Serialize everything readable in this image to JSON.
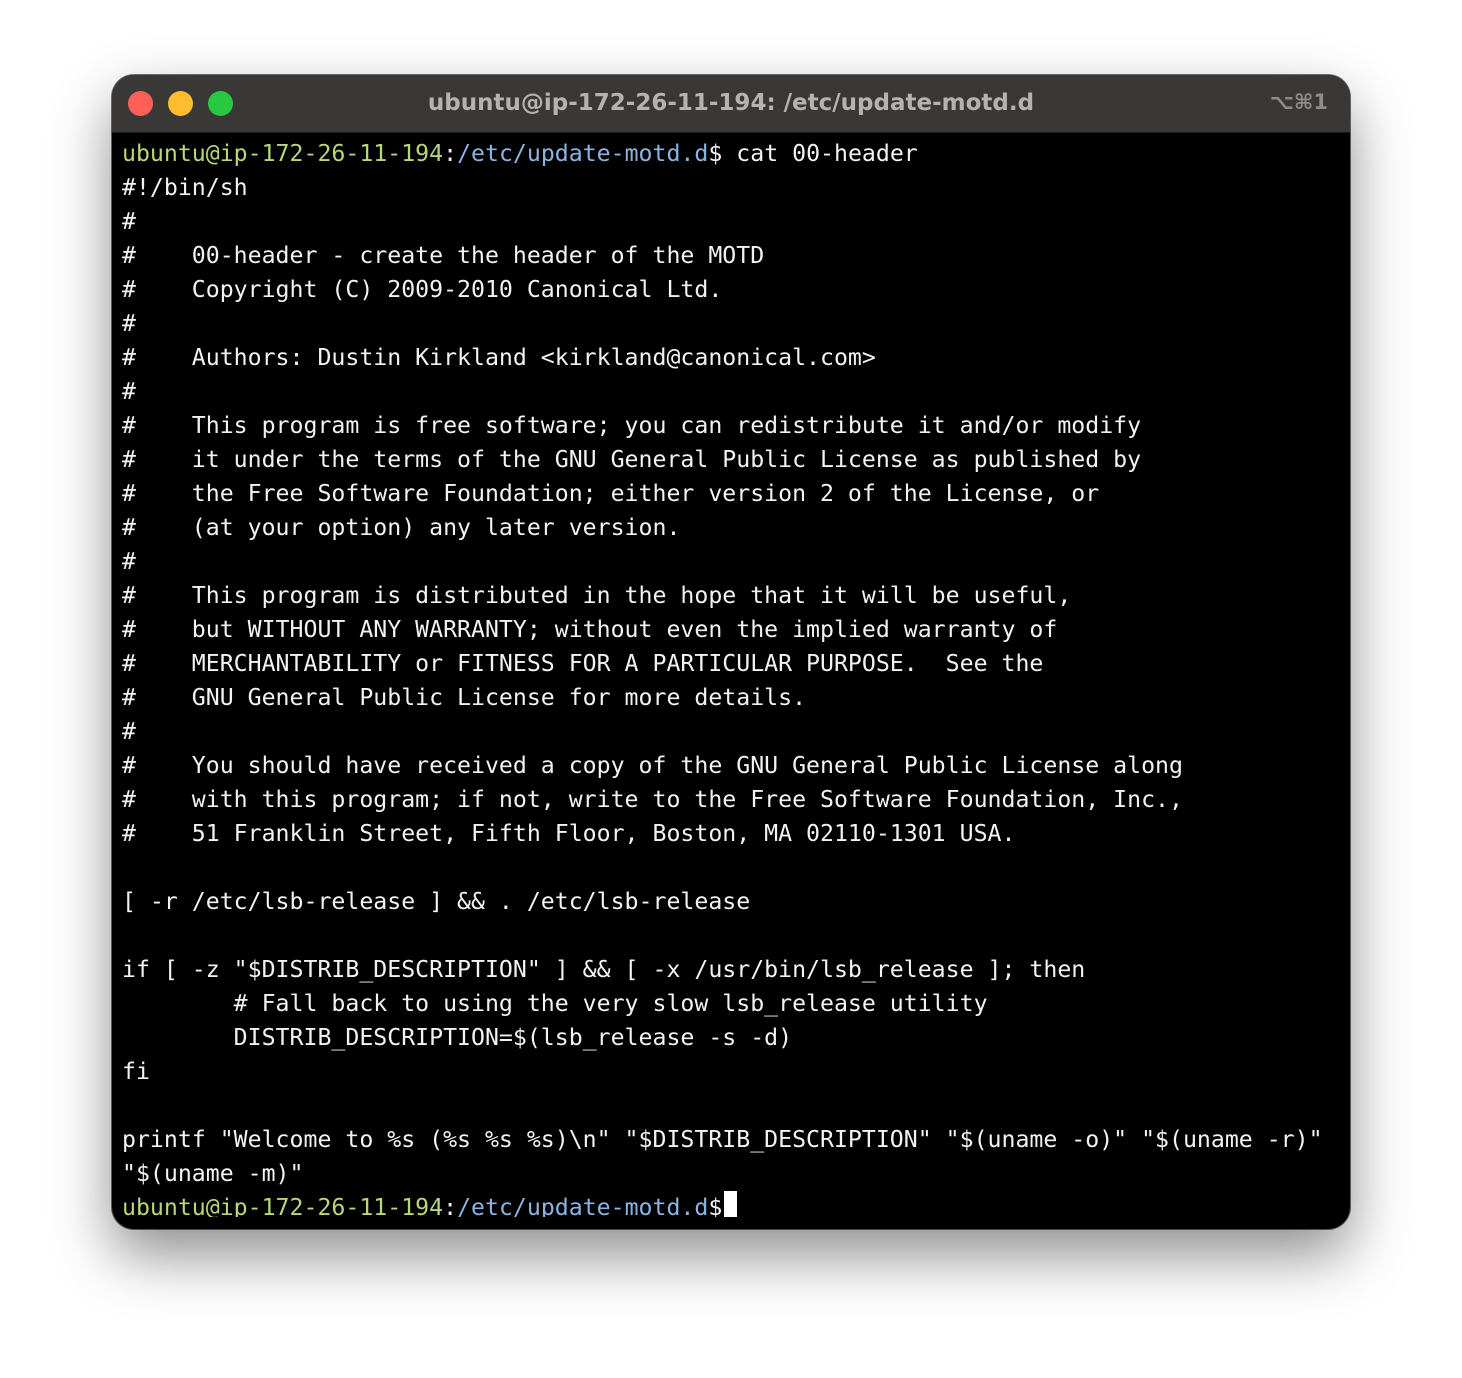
{
  "window": {
    "title": "ubuntu@ip-172-26-11-194: /etc/update-motd.d",
    "shortcut": "⌥⌘1"
  },
  "prompt": {
    "user_host": "ubuntu@ip-172-26-11-194",
    "separator": ":",
    "path": "/etc/update-motd.d",
    "symbol": "$"
  },
  "command": " cat 00-header",
  "output": [
    "#!/bin/sh",
    "#",
    "#    00-header - create the header of the MOTD",
    "#    Copyright (C) 2009-2010 Canonical Ltd.",
    "#",
    "#    Authors: Dustin Kirkland <kirkland@canonical.com>",
    "#",
    "#    This program is free software; you can redistribute it and/or modify",
    "#    it under the terms of the GNU General Public License as published by",
    "#    the Free Software Foundation; either version 2 of the License, or",
    "#    (at your option) any later version.",
    "#",
    "#    This program is distributed in the hope that it will be useful,",
    "#    but WITHOUT ANY WARRANTY; without even the implied warranty of",
    "#    MERCHANTABILITY or FITNESS FOR A PARTICULAR PURPOSE.  See the",
    "#    GNU General Public License for more details.",
    "#",
    "#    You should have received a copy of the GNU General Public License along",
    "#    with this program; if not, write to the Free Software Foundation, Inc.,",
    "#    51 Franklin Street, Fifth Floor, Boston, MA 02110-1301 USA.",
    "",
    "[ -r /etc/lsb-release ] && . /etc/lsb-release",
    "",
    "if [ -z \"$DISTRIB_DESCRIPTION\" ] && [ -x /usr/bin/lsb_release ]; then",
    "        # Fall back to using the very slow lsb_release utility",
    "        DISTRIB_DESCRIPTION=$(lsb_release -s -d)",
    "fi",
    "",
    "printf \"Welcome to %s (%s %s %s)\\n\" \"$DISTRIB_DESCRIPTION\" \"$(uname -o)\" \"$(uname -r)\"",
    "\"$(uname -m)\""
  ],
  "colors": {
    "user_host": "#b8d67a",
    "path": "#8db3e2",
    "text": "#f2f2f2",
    "background": "#000000",
    "titlebar": "#3a3837"
  },
  "icons": {
    "close": "close-icon",
    "minimize": "minimize-icon",
    "maximize": "maximize-icon"
  }
}
